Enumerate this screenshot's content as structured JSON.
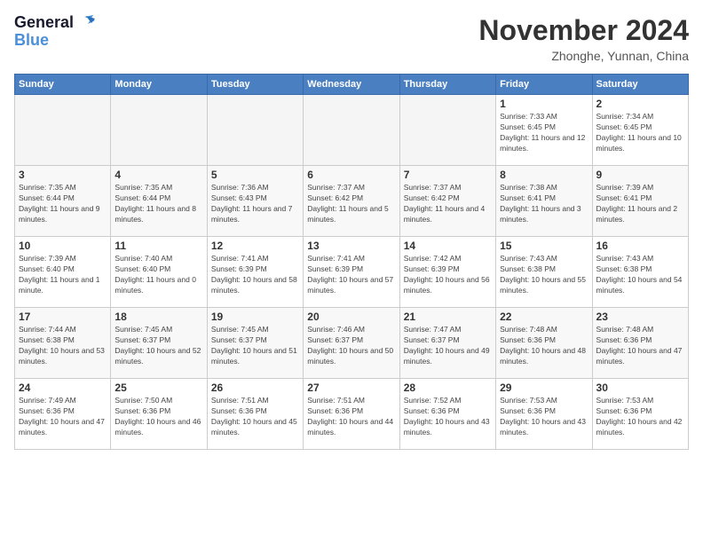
{
  "header": {
    "logo_general": "General",
    "logo_blue": "Blue",
    "month_title": "November 2024",
    "location": "Zhonghe, Yunnan, China"
  },
  "days_of_week": [
    "Sunday",
    "Monday",
    "Tuesday",
    "Wednesday",
    "Thursday",
    "Friday",
    "Saturday"
  ],
  "weeks": [
    [
      {
        "day": "",
        "info": "",
        "empty": true
      },
      {
        "day": "",
        "info": "",
        "empty": true
      },
      {
        "day": "",
        "info": "",
        "empty": true
      },
      {
        "day": "",
        "info": "",
        "empty": true
      },
      {
        "day": "",
        "info": "",
        "empty": true
      },
      {
        "day": "1",
        "info": "Sunrise: 7:33 AM\nSunset: 6:45 PM\nDaylight: 11 hours and 12 minutes."
      },
      {
        "day": "2",
        "info": "Sunrise: 7:34 AM\nSunset: 6:45 PM\nDaylight: 11 hours and 10 minutes."
      }
    ],
    [
      {
        "day": "3",
        "info": "Sunrise: 7:35 AM\nSunset: 6:44 PM\nDaylight: 11 hours and 9 minutes."
      },
      {
        "day": "4",
        "info": "Sunrise: 7:35 AM\nSunset: 6:44 PM\nDaylight: 11 hours and 8 minutes."
      },
      {
        "day": "5",
        "info": "Sunrise: 7:36 AM\nSunset: 6:43 PM\nDaylight: 11 hours and 7 minutes."
      },
      {
        "day": "6",
        "info": "Sunrise: 7:37 AM\nSunset: 6:42 PM\nDaylight: 11 hours and 5 minutes."
      },
      {
        "day": "7",
        "info": "Sunrise: 7:37 AM\nSunset: 6:42 PM\nDaylight: 11 hours and 4 minutes."
      },
      {
        "day": "8",
        "info": "Sunrise: 7:38 AM\nSunset: 6:41 PM\nDaylight: 11 hours and 3 minutes."
      },
      {
        "day": "9",
        "info": "Sunrise: 7:39 AM\nSunset: 6:41 PM\nDaylight: 11 hours and 2 minutes."
      }
    ],
    [
      {
        "day": "10",
        "info": "Sunrise: 7:39 AM\nSunset: 6:40 PM\nDaylight: 11 hours and 1 minute."
      },
      {
        "day": "11",
        "info": "Sunrise: 7:40 AM\nSunset: 6:40 PM\nDaylight: 11 hours and 0 minutes."
      },
      {
        "day": "12",
        "info": "Sunrise: 7:41 AM\nSunset: 6:39 PM\nDaylight: 10 hours and 58 minutes."
      },
      {
        "day": "13",
        "info": "Sunrise: 7:41 AM\nSunset: 6:39 PM\nDaylight: 10 hours and 57 minutes."
      },
      {
        "day": "14",
        "info": "Sunrise: 7:42 AM\nSunset: 6:39 PM\nDaylight: 10 hours and 56 minutes."
      },
      {
        "day": "15",
        "info": "Sunrise: 7:43 AM\nSunset: 6:38 PM\nDaylight: 10 hours and 55 minutes."
      },
      {
        "day": "16",
        "info": "Sunrise: 7:43 AM\nSunset: 6:38 PM\nDaylight: 10 hours and 54 minutes."
      }
    ],
    [
      {
        "day": "17",
        "info": "Sunrise: 7:44 AM\nSunset: 6:38 PM\nDaylight: 10 hours and 53 minutes."
      },
      {
        "day": "18",
        "info": "Sunrise: 7:45 AM\nSunset: 6:37 PM\nDaylight: 10 hours and 52 minutes."
      },
      {
        "day": "19",
        "info": "Sunrise: 7:45 AM\nSunset: 6:37 PM\nDaylight: 10 hours and 51 minutes."
      },
      {
        "day": "20",
        "info": "Sunrise: 7:46 AM\nSunset: 6:37 PM\nDaylight: 10 hours and 50 minutes."
      },
      {
        "day": "21",
        "info": "Sunrise: 7:47 AM\nSunset: 6:37 PM\nDaylight: 10 hours and 49 minutes."
      },
      {
        "day": "22",
        "info": "Sunrise: 7:48 AM\nSunset: 6:36 PM\nDaylight: 10 hours and 48 minutes."
      },
      {
        "day": "23",
        "info": "Sunrise: 7:48 AM\nSunset: 6:36 PM\nDaylight: 10 hours and 47 minutes."
      }
    ],
    [
      {
        "day": "24",
        "info": "Sunrise: 7:49 AM\nSunset: 6:36 PM\nDaylight: 10 hours and 47 minutes."
      },
      {
        "day": "25",
        "info": "Sunrise: 7:50 AM\nSunset: 6:36 PM\nDaylight: 10 hours and 46 minutes."
      },
      {
        "day": "26",
        "info": "Sunrise: 7:51 AM\nSunset: 6:36 PM\nDaylight: 10 hours and 45 minutes."
      },
      {
        "day": "27",
        "info": "Sunrise: 7:51 AM\nSunset: 6:36 PM\nDaylight: 10 hours and 44 minutes."
      },
      {
        "day": "28",
        "info": "Sunrise: 7:52 AM\nSunset: 6:36 PM\nDaylight: 10 hours and 43 minutes."
      },
      {
        "day": "29",
        "info": "Sunrise: 7:53 AM\nSunset: 6:36 PM\nDaylight: 10 hours and 43 minutes."
      },
      {
        "day": "30",
        "info": "Sunrise: 7:53 AM\nSunset: 6:36 PM\nDaylight: 10 hours and 42 minutes."
      }
    ]
  ]
}
